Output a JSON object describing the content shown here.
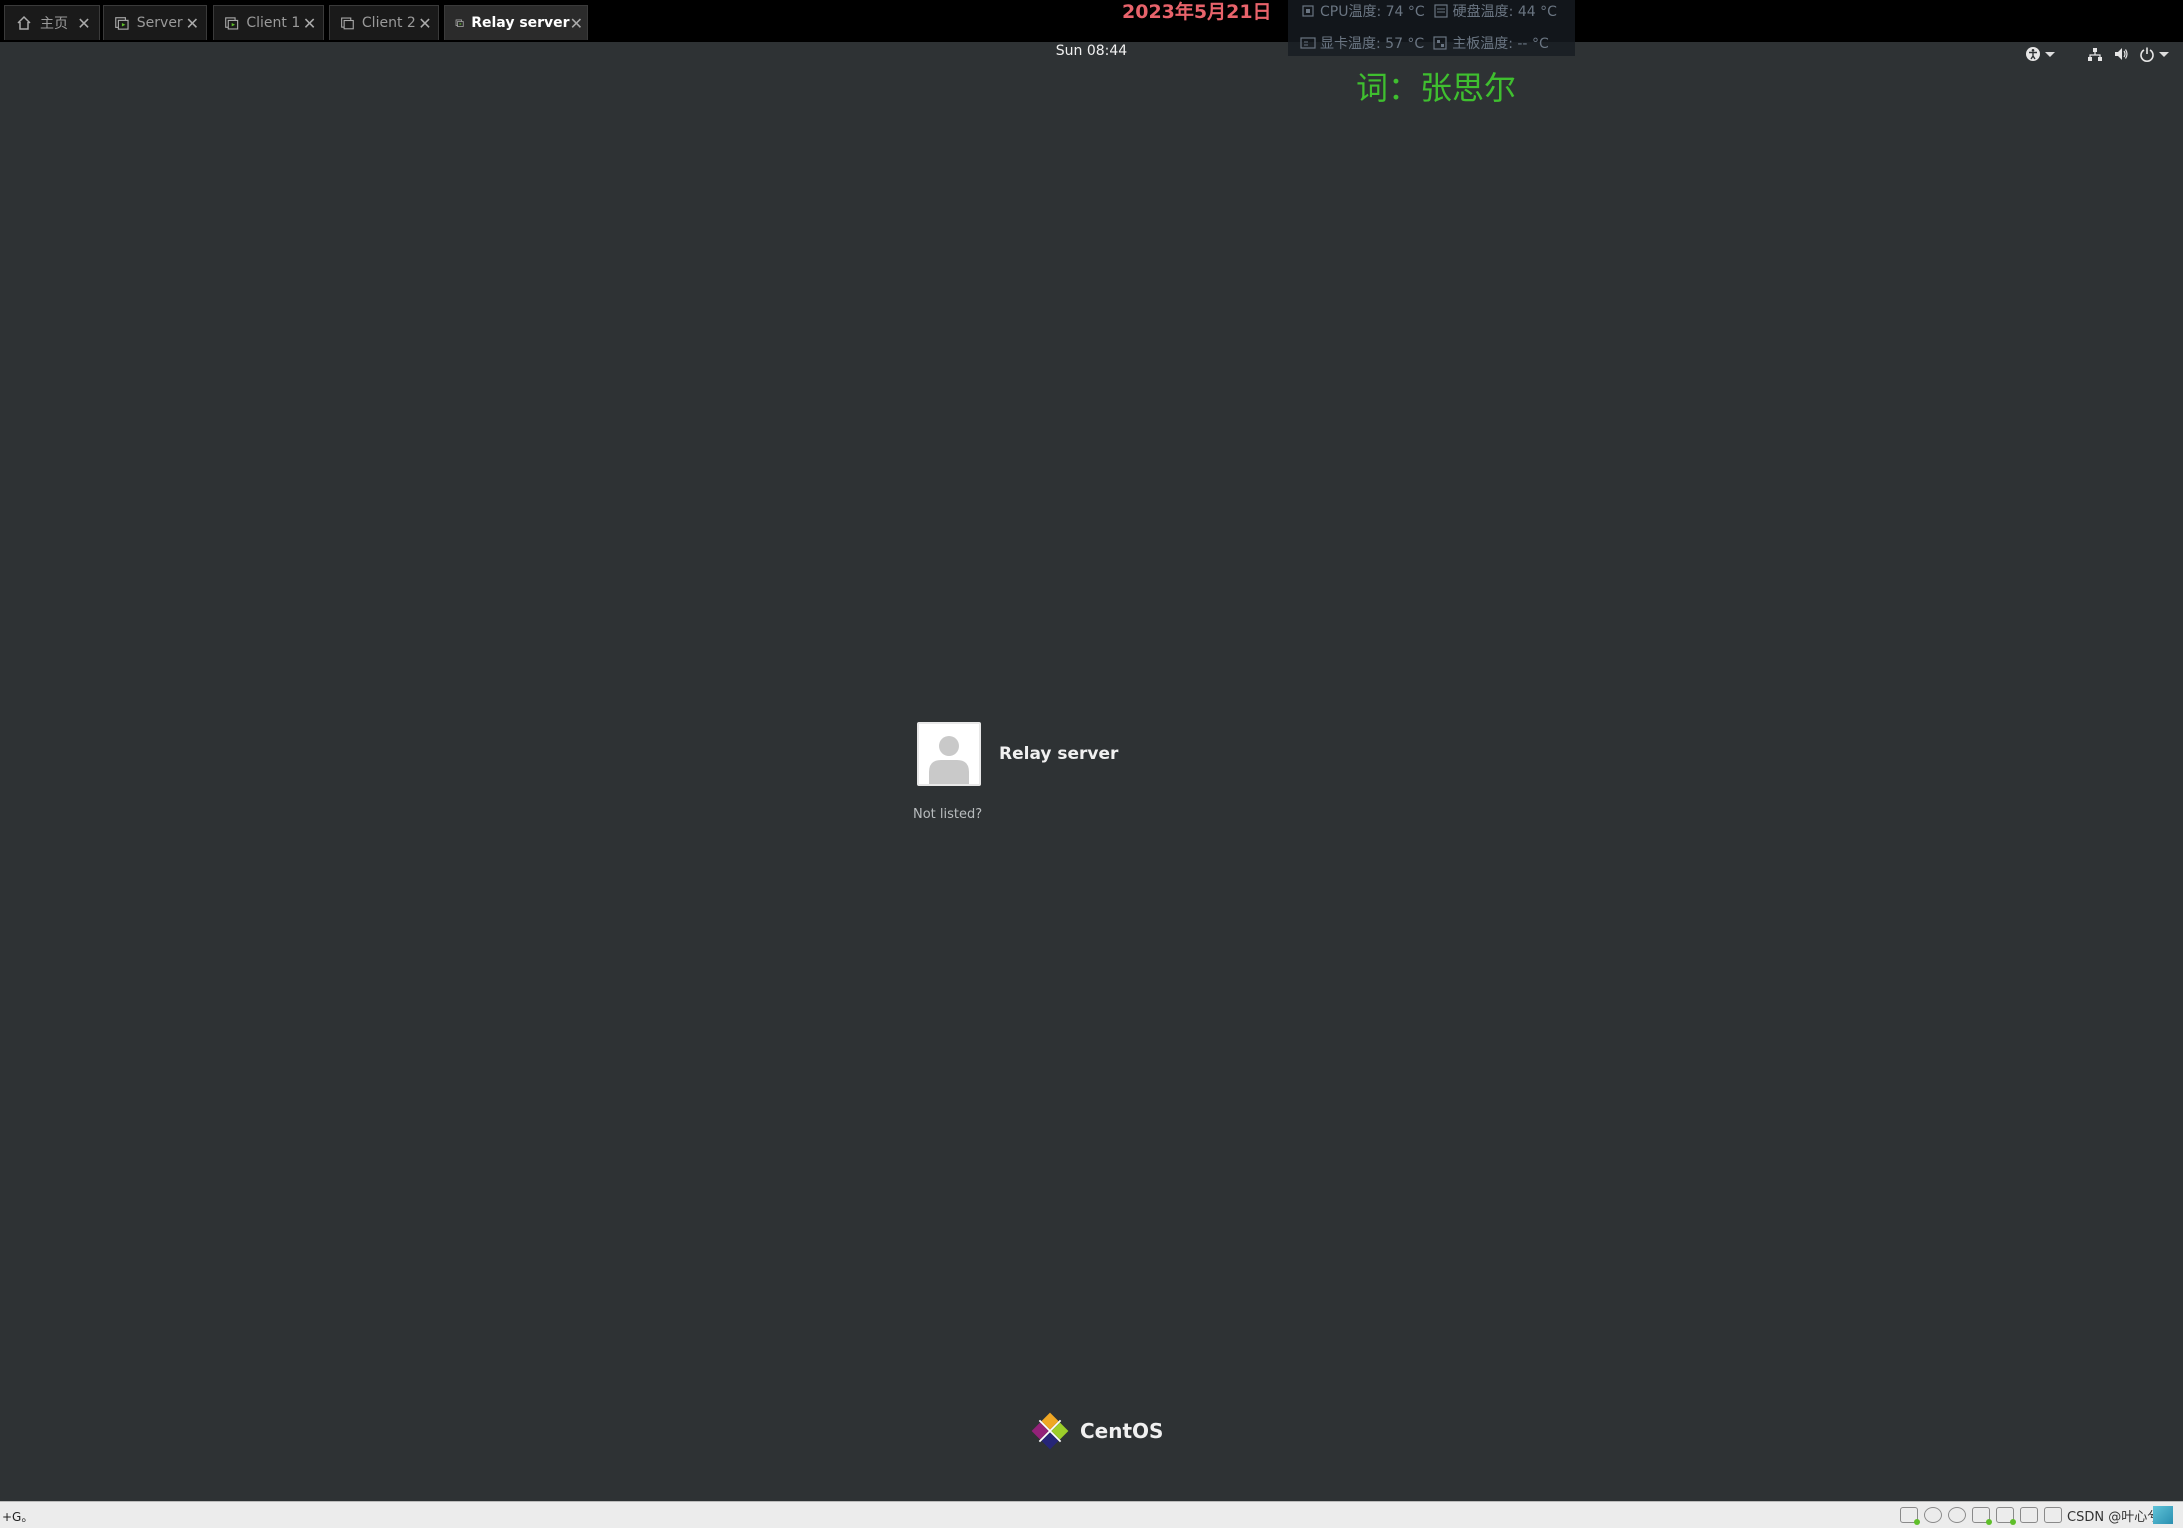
{
  "tabs": [
    {
      "label": "主页",
      "icon": "home-icon",
      "active": false
    },
    {
      "label": "Server",
      "icon": "vm-running-icon",
      "active": false
    },
    {
      "label": "Client 1",
      "icon": "vm-running-icon",
      "active": false
    },
    {
      "label": "Client 2",
      "icon": "vm-off-icon",
      "active": false
    },
    {
      "label": "Relay server",
      "icon": "vm-running-icon",
      "active": true
    }
  ],
  "overlay": {
    "date": "2023年5月21日",
    "lyric": "词：张思尔",
    "temps": {
      "cpu": "CPU温度: 74 °C",
      "disk": "硬盘温度: 44 °C",
      "gpu": "显卡温度: 57 °C",
      "board": "主板温度: -- °C"
    }
  },
  "topbar": {
    "clock": "Sun 08:44",
    "icons": [
      "accessibility-icon",
      "network-icon",
      "volume-icon",
      "power-icon"
    ]
  },
  "login": {
    "username": "Relay server",
    "not_listed": "Not listed?"
  },
  "branding": {
    "logo_text": "CentOS"
  },
  "statusbar": {
    "hint": "+G。",
    "watermark": "CSDN @叶心兮"
  },
  "colors": {
    "background": "#2e3234",
    "date_color": "#e8636b",
    "lyric_color": "#3fbf2f",
    "statusbar": "#ececec"
  }
}
